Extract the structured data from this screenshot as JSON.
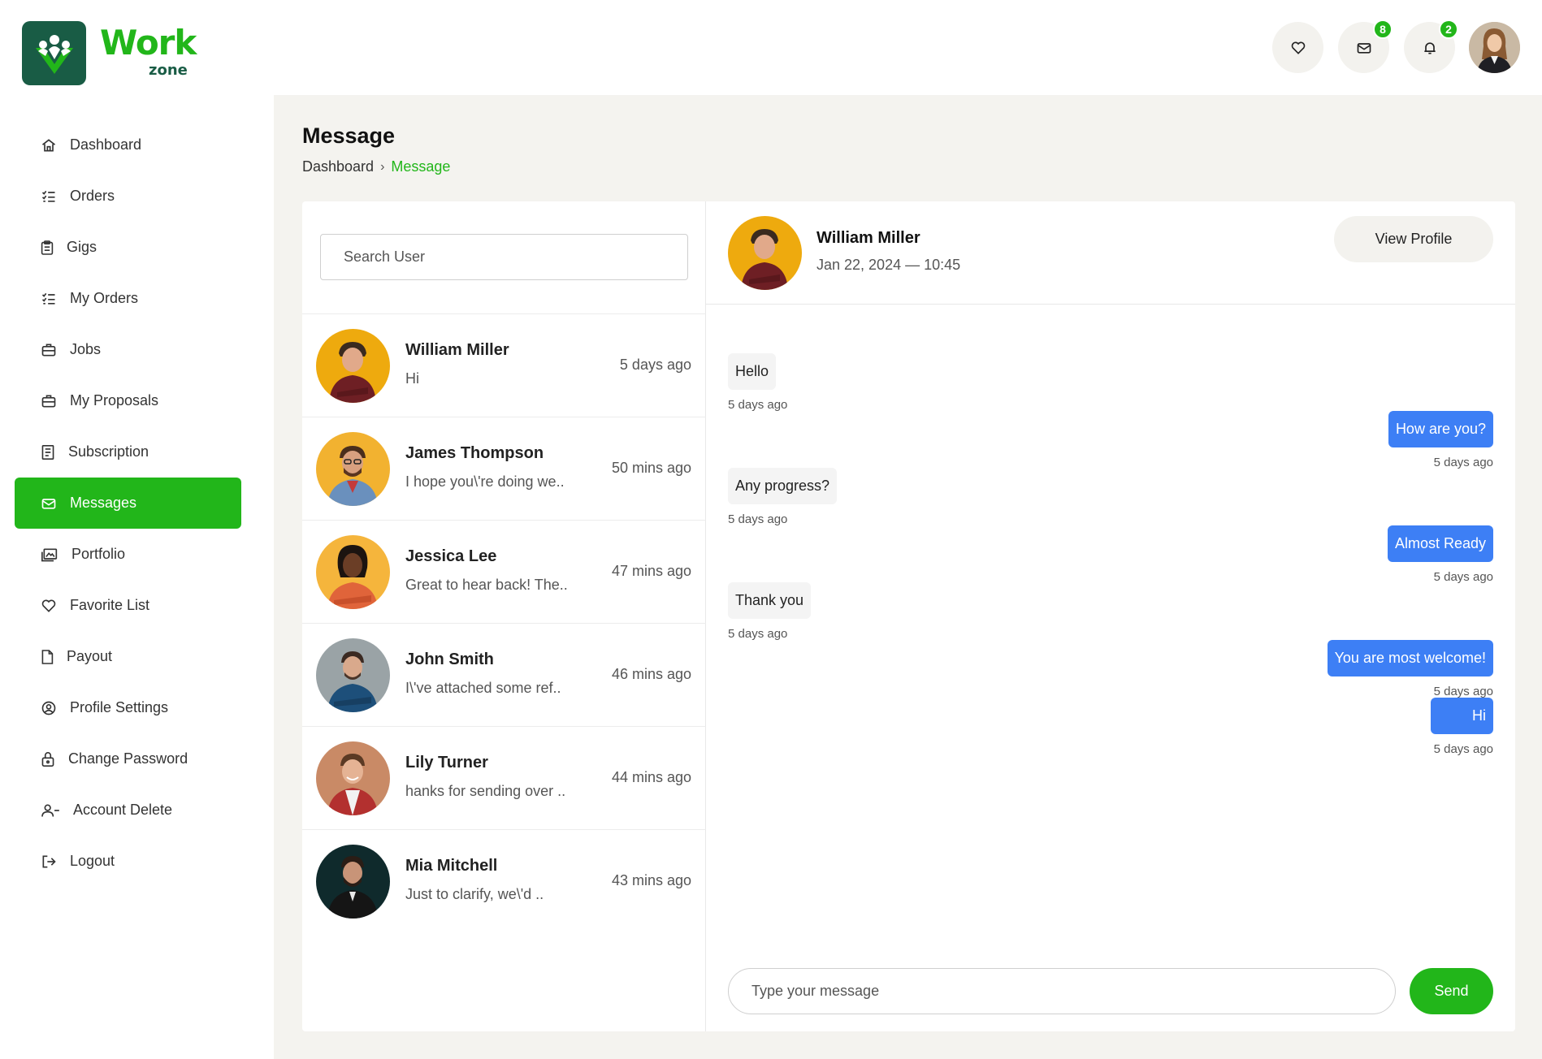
{
  "brand": {
    "name_line1": "Work",
    "name_line2": "zone",
    "icon": "workzone-logo-icon",
    "colors": {
      "primary": "#22b61a",
      "dark": "#195c45",
      "accent_blue": "#3d7ff5"
    }
  },
  "header": {
    "favorites_icon": "heart-icon",
    "messages_icon": "mail-icon",
    "messages_count": "8",
    "notifications_icon": "bell-icon",
    "notifications_count": "2",
    "profile_icon": "user-avatar"
  },
  "sidebar": {
    "items": [
      {
        "label": "Dashboard",
        "icon": "home-icon",
        "active": false
      },
      {
        "label": "Orders",
        "icon": "checklist-icon",
        "active": false
      },
      {
        "label": "Gigs",
        "icon": "clipboard-icon",
        "active": false
      },
      {
        "label": "My Orders",
        "icon": "checklist-icon",
        "active": false
      },
      {
        "label": "Jobs",
        "icon": "briefcase-icon",
        "active": false
      },
      {
        "label": "My Proposals",
        "icon": "briefcase-icon",
        "active": false
      },
      {
        "label": "Subscription",
        "icon": "receipt-icon",
        "active": false
      },
      {
        "label": "Messages",
        "icon": "mail-icon",
        "active": true
      },
      {
        "label": "Portfolio",
        "icon": "gallery-icon",
        "active": false
      },
      {
        "label": "Favorite List",
        "icon": "heart-icon",
        "active": false
      },
      {
        "label": "Payout",
        "icon": "file-icon",
        "active": false
      },
      {
        "label": "Profile Settings",
        "icon": "user-circle-icon",
        "active": false
      },
      {
        "label": "Change Password",
        "icon": "lock-icon",
        "active": false
      },
      {
        "label": "Account Delete",
        "icon": "user-minus-icon",
        "active": false
      },
      {
        "label": "Logout",
        "icon": "logout-icon",
        "active": false
      }
    ]
  },
  "page": {
    "title": "Message",
    "breadcrumb": {
      "home": "Dashboard",
      "separator": "›",
      "current": "Message"
    }
  },
  "users": {
    "search_placeholder": "Search User",
    "list": [
      {
        "name": "William Miller",
        "preview": "Hi",
        "time": "5 days ago"
      },
      {
        "name": "James Thompson",
        "preview": "I hope you\\'re doing we..",
        "time": "50 mins ago"
      },
      {
        "name": "Jessica Lee",
        "preview": "Great to hear back! The..",
        "time": "47 mins ago"
      },
      {
        "name": "John Smith",
        "preview": "I\\'ve attached some ref..",
        "time": "46 mins ago"
      },
      {
        "name": "Lily Turner",
        "preview": "hanks for sending over ..",
        "time": "44 mins ago"
      },
      {
        "name": "Mia Mitchell",
        "preview": "Just to clarify, we\\'d ..",
        "time": "43 mins ago"
      }
    ]
  },
  "chat": {
    "name": "William Miller",
    "datetime": "Jan 22, 2024 — 10:45",
    "view_profile_label": "View Profile",
    "messages": [
      {
        "direction": "received",
        "text": "Hello",
        "time": "5 days ago"
      },
      {
        "direction": "sent",
        "text": "How are you?",
        "time": "5 days ago"
      },
      {
        "direction": "received",
        "text": "Any progress?",
        "time": "5 days ago"
      },
      {
        "direction": "sent",
        "text": "Almost Ready",
        "time": "5 days ago"
      },
      {
        "direction": "received",
        "text": "Thank you",
        "time": "5 days ago"
      },
      {
        "direction": "sent",
        "text": "You are most welcome!",
        "time": "5 days ago"
      },
      {
        "direction": "sent",
        "text": "Hi",
        "time": "5 days ago"
      }
    ],
    "composer_placeholder": "Type your message",
    "send_label": "Send"
  }
}
